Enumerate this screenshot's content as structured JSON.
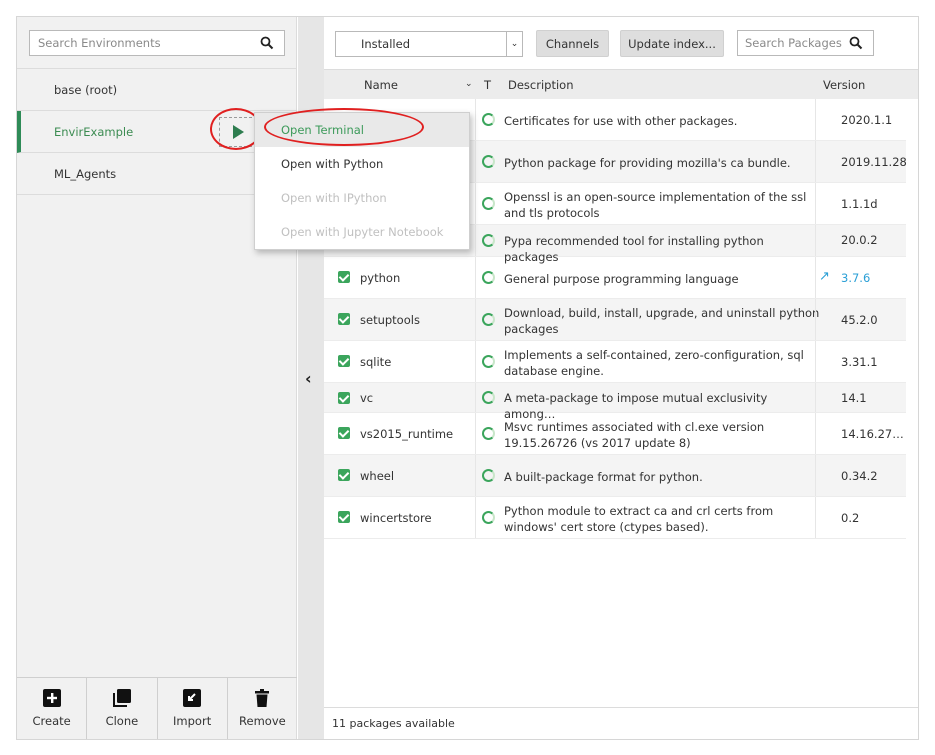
{
  "environments": {
    "search_placeholder": "Search Environments",
    "items": [
      {
        "label": "base (root)"
      },
      {
        "label": "EnvirExample"
      },
      {
        "label": "ML_Agents"
      }
    ],
    "active_index": 1
  },
  "context_menu": {
    "items": [
      {
        "label": "Open Terminal",
        "state": "highlighted"
      },
      {
        "label": "Open with Python",
        "state": "enabled"
      },
      {
        "label": "Open with IPython",
        "state": "disabled"
      },
      {
        "label": "Open with Jupyter Notebook",
        "state": "disabled"
      }
    ]
  },
  "env_actions": [
    {
      "label": "Create",
      "icon": "plus-square-icon"
    },
    {
      "label": "Clone",
      "icon": "copy-icon"
    },
    {
      "label": "Import",
      "icon": "import-icon"
    },
    {
      "label": "Remove",
      "icon": "trash-icon"
    }
  ],
  "toolbar": {
    "filter_selected": "Installed",
    "channels_label": "Channels",
    "update_label": "Update index...",
    "search_placeholder": "Search Packages"
  },
  "table": {
    "headers": {
      "name": "Name",
      "type": "T",
      "description": "Description",
      "version": "Version"
    },
    "rows": [
      {
        "name": "",
        "description": "Certificates for use with other packages.",
        "version": "2020.1.1"
      },
      {
        "name": "",
        "description": "Python package for providing mozilla's ca bundle.",
        "version": "2019.11.28"
      },
      {
        "name": "",
        "description": "Openssl is an open-source implementation of the ssl and tls protocols",
        "version": "1.1.1d"
      },
      {
        "name": "",
        "description": "Pypa recommended tool for installing python packages",
        "version": "20.0.2"
      },
      {
        "name": "python",
        "description": "General purpose programming language",
        "version": "3.7.6",
        "update_available": true
      },
      {
        "name": "setuptools",
        "description": "Download, build, install, upgrade, and uninstall python packages",
        "version": "45.2.0"
      },
      {
        "name": "sqlite",
        "description": "Implements a self-contained, zero-configuration, sql database engine.",
        "version": "3.31.1"
      },
      {
        "name": "vc",
        "description": "A meta-package to impose mutual exclusivity among…",
        "version": "14.1"
      },
      {
        "name": "vs2015_runtime",
        "description": "Msvc runtimes associated with cl.exe version 19.15.26726 (vs 2017 update 8)",
        "version": "14.16.27…"
      },
      {
        "name": "wheel",
        "description": "A built-package format for python.",
        "version": "0.34.2"
      },
      {
        "name": "wincertstore",
        "description": "Python module to extract ca and crl certs from windows' cert store (ctypes based).",
        "version": "0.2"
      }
    ]
  },
  "footer": {
    "status": "11 packages available"
  },
  "colors": {
    "accent_green": "#3ba55c",
    "active_text": "#3c8c52",
    "annotation_red": "#e02020",
    "update_blue": "#2a9fd6"
  }
}
